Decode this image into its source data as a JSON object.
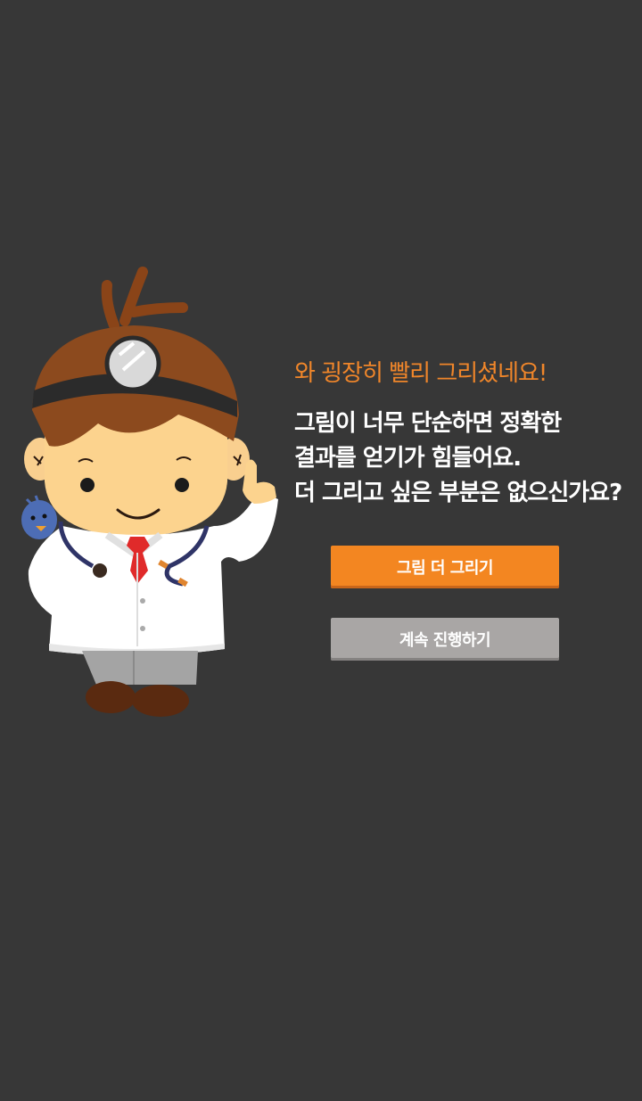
{
  "dialog": {
    "headline": "와 굉장히 빨리 그리셨네요!",
    "message_lines": [
      "그림이 너무 단순하면 정확한",
      "결과를 얻기가 힘들어요.",
      "더 그리고 싶은 부분은 없으신가요?"
    ],
    "draw_more_label": "그림 더 그리기",
    "continue_label": "계속 진행하기"
  },
  "illustration": {
    "name": "doctor-character",
    "accent_colors": {
      "background": "#373737",
      "headline": "#f0862a",
      "primary_button": "#f38621",
      "secondary_button": "#a9a6a5"
    }
  }
}
